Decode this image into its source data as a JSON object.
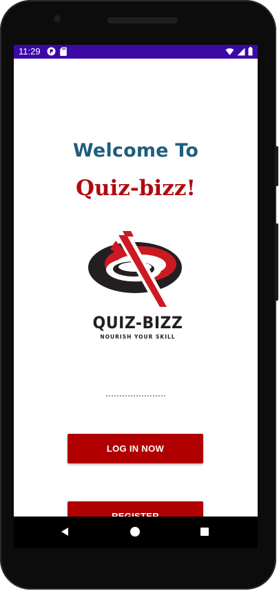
{
  "status_bar": {
    "time": "11:29",
    "background": "#3c09a6",
    "left_icons": [
      "cast-notification-icon",
      "sd-card-icon"
    ],
    "right_icons": [
      "wifi-icon",
      "cell-signal-icon",
      "battery-icon"
    ]
  },
  "main": {
    "welcome_text": "Welcome To",
    "welcome_color": "#1f5e7e",
    "app_name": "Quiz-bizz!",
    "app_name_color": "#b00b0e",
    "logo": {
      "title": "QUIZ-BIZZ",
      "tagline": "NOURISH YOUR SKILL"
    },
    "login_button": "LOG IN NOW",
    "register_button": "REGISTER",
    "button_color": "#b10001"
  },
  "nav_bar": {
    "buttons": [
      "back-icon",
      "home-icon",
      "recents-icon"
    ]
  }
}
